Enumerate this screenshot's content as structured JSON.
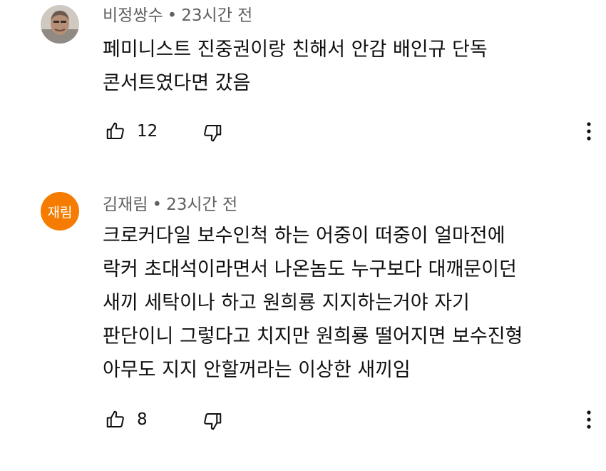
{
  "comments": [
    {
      "author": "비정쌍수",
      "separator": "•",
      "time": "23시간 전",
      "avatar_type": "photo",
      "text_lines": [
        "페미니스트 진중권이랑 친해서 안감 배인규 단독",
        "콘서트였다면 갔음"
      ],
      "like_count": "12",
      "icons": {
        "like": "thumbs-up-icon",
        "dislike": "thumbs-down-icon",
        "more": "more-vert-icon"
      }
    },
    {
      "author": "김재림",
      "separator": "•",
      "time": "23시간 전",
      "avatar_type": "initials",
      "avatar_initials": "재림",
      "avatar_color": "#f57c00",
      "text_lines": [
        "크로커다일 보수인척 하는 어중이 떠중이 얼마전에",
        "락커 초대석이라면서 나온놈도 누구보다 대깨문이던",
        "새끼 세탁이나 하고 원희룡 지지하는거야 자기",
        "판단이니 그렇다고 치지만 원희룡 떨어지면 보수진형",
        "아무도 지지 안할꺼라는 이상한 새끼임"
      ],
      "like_count": "8",
      "icons": {
        "like": "thumbs-up-icon",
        "dislike": "thumbs-down-icon",
        "more": "more-vert-icon"
      }
    }
  ]
}
